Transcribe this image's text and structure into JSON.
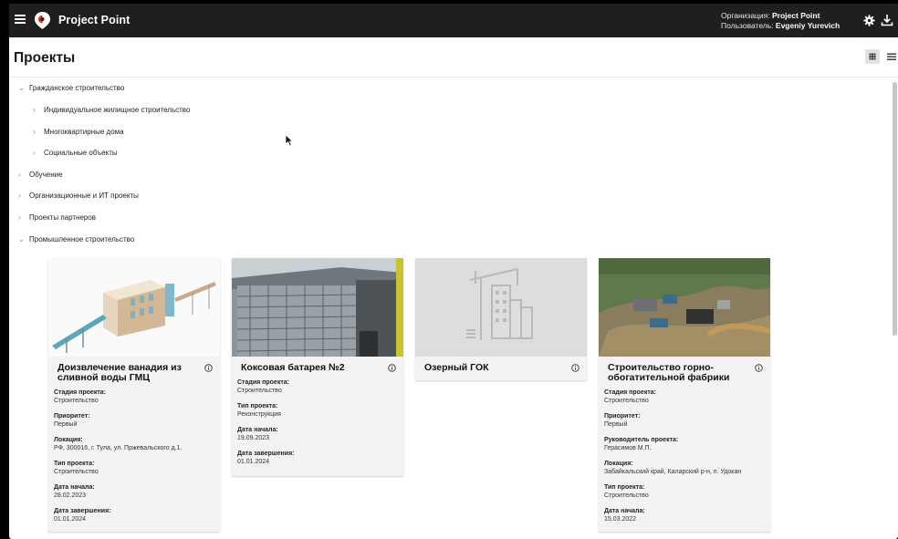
{
  "app": {
    "brand": "Project Point",
    "org_label": "Организация:",
    "org_value": "Project Point",
    "user_label": "Пользователь:",
    "user_value": "Evgeniy Yurevich"
  },
  "page": {
    "title": "Проекты"
  },
  "tree": [
    {
      "label": "Гражданское строительство",
      "expanded": true
    },
    {
      "label": "Индивидуальное жилищное строительство",
      "expanded": false
    },
    {
      "label": "Многоквартирные дома",
      "expanded": false
    },
    {
      "label": "Социальные объекты",
      "expanded": false
    },
    {
      "label": "Обучение",
      "expanded": false
    },
    {
      "label": "Организационные и ИТ проекты",
      "expanded": false
    },
    {
      "label": "Проекты партнеров",
      "expanded": false
    },
    {
      "label": "Промышленное строительство",
      "expanded": true
    }
  ],
  "cards": [
    {
      "title": "Доизвлечение ванадия из сливной воды ГМЦ",
      "fields": [
        {
          "label": "Стадия проекта:",
          "value": "Строительство"
        },
        {
          "label": "Приоритет:",
          "value": "Первый"
        },
        {
          "label": "Локация:",
          "value": "РФ, 300016, г. Тула, ул. Пржевальского д.1."
        },
        {
          "label": "Тип проекта:",
          "value": "Строительство"
        },
        {
          "label": "Дата начала:",
          "value": "28.02.2023"
        },
        {
          "label": "Дата завершения:",
          "value": "01.01.2024"
        }
      ]
    },
    {
      "title": "Коксовая батарея №2",
      "fields": [
        {
          "label": "Стадия проекта:",
          "value": "Строительство"
        },
        {
          "label": "Тип проекта:",
          "value": "Реконструкция"
        },
        {
          "label": "Дата начала:",
          "value": "19.09.2023"
        },
        {
          "label": "Дата завершения:",
          "value": "01.01.2024"
        }
      ]
    },
    {
      "title": "Озерный ГОК",
      "fields": []
    },
    {
      "title": "Строительство горно-обогатительной фабрики",
      "fields": [
        {
          "label": "Стадия проекта:",
          "value": "Строительство"
        },
        {
          "label": "Приоритет:",
          "value": "Первый"
        },
        {
          "label": "Руководитель проекта:",
          "value": "Герасимов М.П."
        },
        {
          "label": "Локация:",
          "value": "Забайкальский край, Каларский р-н, п. Удокан"
        },
        {
          "label": "Тип проекта:",
          "value": "Строительство"
        },
        {
          "label": "Дата начала:",
          "value": "15.03.2022"
        }
      ]
    }
  ],
  "icons": {
    "menu": "menu-icon",
    "logo": "project-point-logo",
    "settings": "gear-icon",
    "download": "download-icon",
    "grid_view": "grid-view-icon",
    "list_view": "list-view-icon",
    "info": "info-icon",
    "chevron": "chevron-icon"
  },
  "colors": {
    "topbar": "#1f1f1f",
    "logo_accent": "#e0352b",
    "card_bg": "#f3f3f3"
  }
}
